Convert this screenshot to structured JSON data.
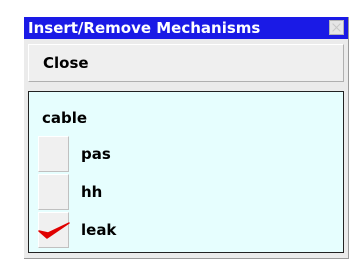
{
  "window": {
    "title": "Insert/Remove Mechanisms",
    "close_box_icon": "close-box-icon"
  },
  "buttons": {
    "close_label": "Close"
  },
  "section": {
    "title": "cable",
    "mechanisms": [
      {
        "label": "pas",
        "checked": false
      },
      {
        "label": "hh",
        "checked": false
      },
      {
        "label": "leak",
        "checked": true
      }
    ]
  },
  "colors": {
    "titlebar": "#1a1ae6",
    "panel_background": "#e6fefe",
    "checkmark": "#e00000"
  }
}
